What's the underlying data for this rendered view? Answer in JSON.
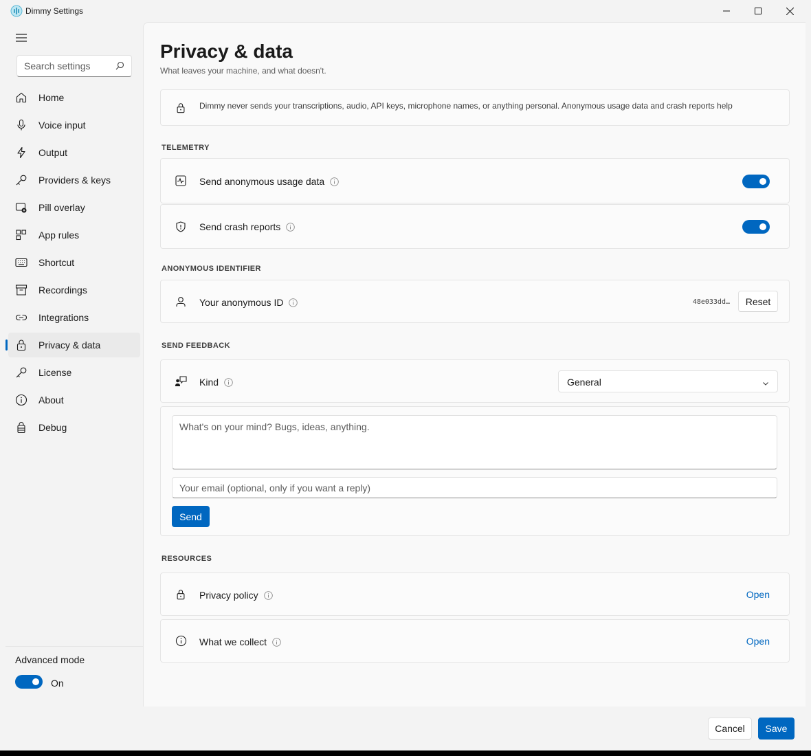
{
  "window": {
    "title": "Dimmy Settings"
  },
  "sidebar": {
    "search_placeholder": "Search settings",
    "items": [
      {
        "label": "Home",
        "icon": "home-icon"
      },
      {
        "label": "Voice input",
        "icon": "microphone-icon"
      },
      {
        "label": "Output",
        "icon": "lightning-icon"
      },
      {
        "label": "Providers & keys",
        "icon": "key-icon"
      },
      {
        "label": "Pill overlay",
        "icon": "overlay-icon"
      },
      {
        "label": "App rules",
        "icon": "app-rules-icon"
      },
      {
        "label": "Shortcut",
        "icon": "keyboard-icon"
      },
      {
        "label": "Recordings",
        "icon": "archive-icon"
      },
      {
        "label": "Integrations",
        "icon": "link-icon"
      },
      {
        "label": "Privacy & data",
        "icon": "lock-icon"
      },
      {
        "label": "License",
        "icon": "key-icon"
      },
      {
        "label": "About",
        "icon": "info-icon"
      },
      {
        "label": "Debug",
        "icon": "debug-icon"
      }
    ],
    "active_index": 9,
    "advanced_mode": {
      "label": "Advanced mode",
      "state": "On",
      "enabled": true
    }
  },
  "page": {
    "title": "Privacy & data",
    "subtitle": "What leaves your machine, and what doesn't.",
    "notice": "Dimmy never sends your transcriptions, audio, API keys, microphone names, or anything personal. Anonymous usage data and crash reports help"
  },
  "telemetry": {
    "heading": "TELEMETRY",
    "usage": {
      "label": "Send anonymous usage data",
      "enabled": true
    },
    "crash": {
      "label": "Send crash reports",
      "enabled": true
    }
  },
  "identifier": {
    "heading": "ANONYMOUS IDENTIFIER",
    "label": "Your anonymous ID",
    "value": "48e033dd…",
    "reset_label": "Reset"
  },
  "feedback": {
    "heading": "SEND FEEDBACK",
    "kind_label": "Kind",
    "kind_value": "General",
    "message_placeholder": "What's on your mind? Bugs, ideas, anything.",
    "email_placeholder": "Your email (optional, only if you want a reply)",
    "send_label": "Send"
  },
  "resources": {
    "heading": "RESOURCES",
    "privacy_policy": {
      "label": "Privacy policy",
      "link": "Open"
    },
    "what_we_collect": {
      "label": "What we collect",
      "link": "Open"
    }
  },
  "footer": {
    "cancel_label": "Cancel",
    "save_label": "Save"
  },
  "colors": {
    "accent": "#0067c0",
    "window_bg": "#f3f3f3",
    "content_bg": "#f9f9f9"
  }
}
